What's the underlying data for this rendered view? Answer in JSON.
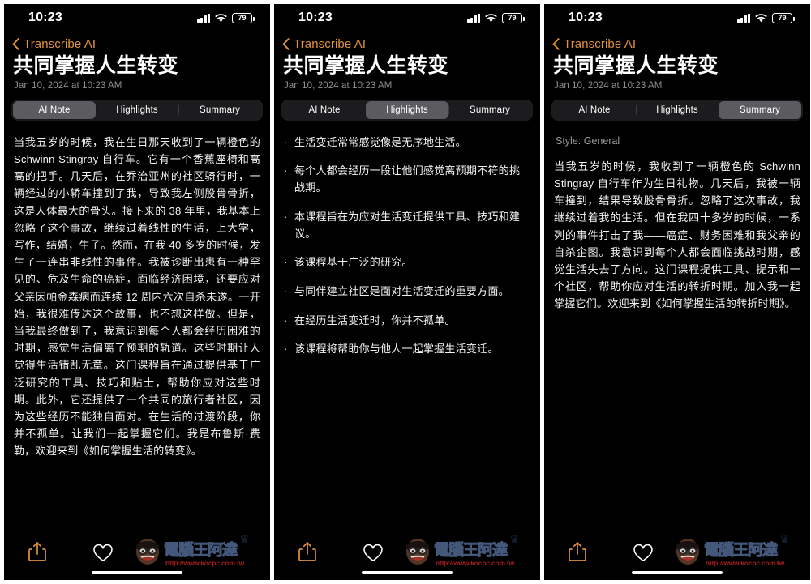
{
  "theme": {
    "accent": "#e0913f",
    "background": "#000000",
    "text": "#f2f2f2",
    "muted": "#8d8d93",
    "segment_track": "#1c1c1e",
    "segment_selected": "#5b5b60"
  },
  "status_bar": {
    "time": "10:23",
    "battery_level": "79",
    "signal_icon": "cellular-signal-icon",
    "wifi_icon": "wifi-icon",
    "battery_icon": "battery-icon"
  },
  "nav": {
    "back_icon": "chevron-left-icon",
    "back_label": "Transcribe AI"
  },
  "header": {
    "title": "共同掌握人生转变",
    "date": "Jan 10, 2024 at 10:23 AM"
  },
  "tabs": [
    {
      "label": "AI Note"
    },
    {
      "label": "Highlights"
    },
    {
      "label": "Summary"
    }
  ],
  "panels": [
    {
      "active_tab": 0,
      "kind": "note",
      "body": "当我五岁的时候，我在生日那天收到了一辆橙色的 Schwinn Stingray 自行车。它有一个香蕉座椅和高高的把手。几天后，在乔治亚州的社区骑行时，一辆经过的小轿车撞到了我，导致我左侧股骨骨折，这是人体最大的骨头。接下来的 38 年里，我基本上忽略了这个事故，继续过着线性的生活，上大学，写作，结婚，生子。然而，在我 40 多岁的时候，发生了一连串非线性的事件。我被诊断出患有一种罕见的、危及生命的癌症，面临经济困境，还要应对父亲因帕金森病而连续 12 周内六次自杀未遂。一开始，我很难传达这个故事，也不想这样做。但是，当我最终做到了，我意识到每个人都会经历困难的时期，感觉生活偏离了预期的轨道。这些时期让人觉得生活错乱无章。这门课程旨在通过提供基于广泛研究的工具、技巧和贴士，帮助你应对这些时期。此外，它还提供了一个共同的旅行者社区，因为这些经历不能独自面对。在生活的过渡阶段，你并不孤单。让我们一起掌握它们。我是布鲁斯·费勒，欢迎来到《如何掌握生活的转变》。"
    },
    {
      "active_tab": 1,
      "kind": "highlights",
      "bullet_marker": "·",
      "bullets": [
        "生活变迁常常感觉像是无序地生活。",
        "每个人都会经历一段让他们感觉离预期不符的挑战期。",
        "本课程旨在为应对生活变迁提供工具、技巧和建议。",
        "该课程基于广泛的研究。",
        "与同伴建立社区是面对生活变迁的重要方面。",
        "在经历生活变迁时，你并不孤单。",
        "该课程将帮助你与他人一起掌握生活变迁。"
      ]
    },
    {
      "active_tab": 2,
      "kind": "summary",
      "style_label": "Style: General",
      "body": "当我五岁的时候，我收到了一辆橙色的 Schwinn Stingray 自行车作为生日礼物。几天后，我被一辆车撞到，结果导致股骨骨折。忽略了这次事故，我继续过着我的生活。但在我四十多岁的时候，一系列的事件打击了我——癌症、财务困难和我父亲的自杀企图。我意识到每个人都会面临挑战时期，感觉生活失去了方向。这门课程提供工具、提示和一个社区，帮助你应对生活的转折时期。加入我一起掌握它们。欢迎来到《如何掌握生活的转折时期》。"
    }
  ],
  "bottom_bar": {
    "share_icon": "share-icon",
    "favorite_icon": "heart-icon"
  },
  "watermark": {
    "brand": "電腦王阿達",
    "url": "http://www.kocpc.com.tw",
    "crown_icon": "crown-icon",
    "mascot_icon": "mascot-face-icon"
  }
}
